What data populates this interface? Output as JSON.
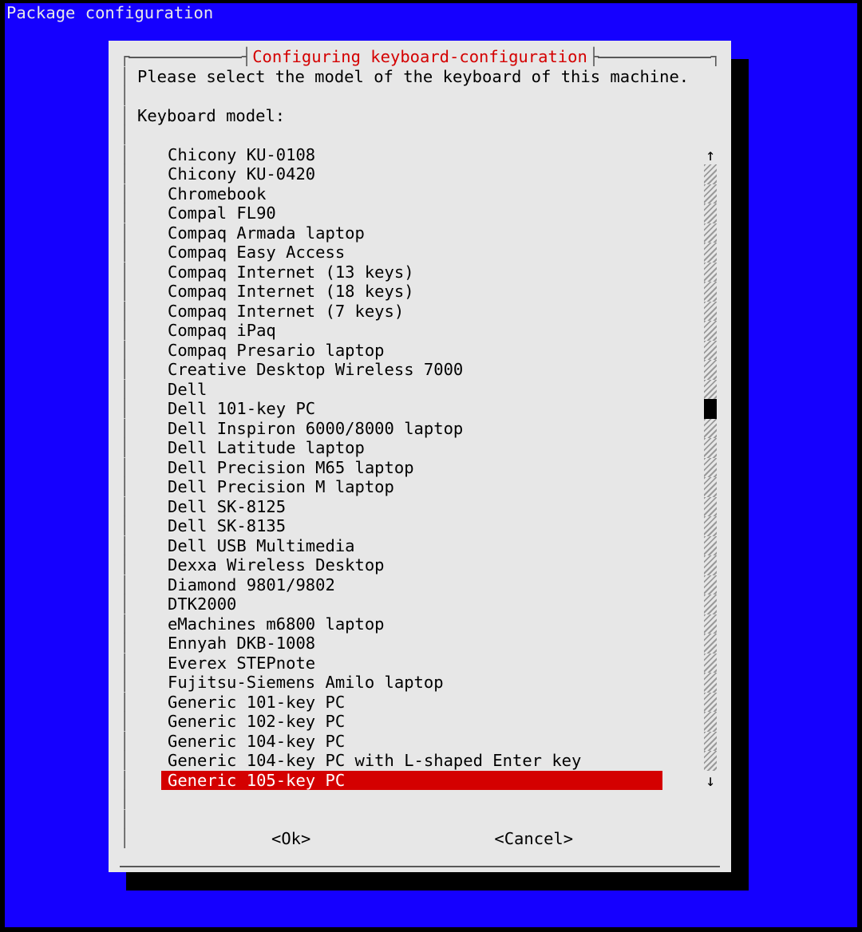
{
  "header_title": "Package configuration",
  "dialog": {
    "title": "Configuring keyboard-configuration",
    "prompt": "Please select the model of the keyboard of this machine.",
    "label": "Keyboard model:",
    "items": [
      "Chicony KU-0108",
      "Chicony KU-0420",
      "Chromebook",
      "Compal FL90",
      "Compaq Armada laptop",
      "Compaq Easy Access",
      "Compaq Internet (13 keys)",
      "Compaq Internet (18 keys)",
      "Compaq Internet (7 keys)",
      "Compaq iPaq",
      "Compaq Presario laptop",
      "Creative Desktop Wireless 7000",
      "Dell",
      "Dell 101-key PC",
      "Dell Inspiron 6000/8000 laptop",
      "Dell Latitude laptop",
      "Dell Precision M65 laptop",
      "Dell Precision M laptop",
      "Dell SK-8125",
      "Dell SK-8135",
      "Dell USB Multimedia",
      "Dexxa Wireless Desktop",
      "Diamond 9801/9802",
      "DTK2000",
      "eMachines m6800 laptop",
      "Ennyah DKB-1008",
      "Everex STEPnote",
      "Fujitsu-Siemens Amilo laptop",
      "Generic 101-key PC",
      "Generic 102-key PC",
      "Generic 104-key PC",
      "Generic 104-key PC with L-shaped Enter key",
      "Generic 105-key PC"
    ],
    "selected_index": 32,
    "scroll_thumb_index": 12,
    "scroll_arrow_up": "↑",
    "scroll_arrow_down": "↓",
    "ok_label": "<Ok>",
    "cancel_label": "<Cancel>"
  }
}
